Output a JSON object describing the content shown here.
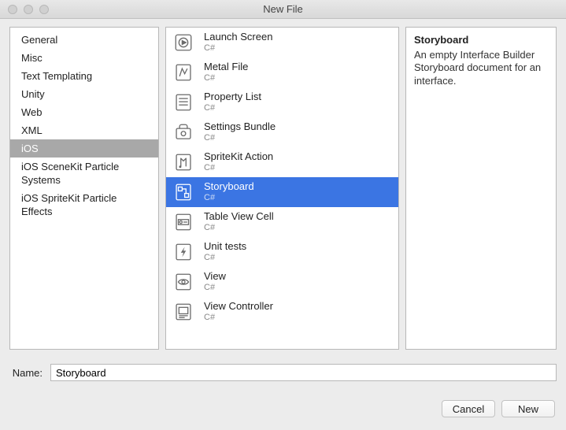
{
  "window": {
    "title": "New File"
  },
  "categories": [
    {
      "label": "General",
      "selected": false
    },
    {
      "label": "Misc",
      "selected": false
    },
    {
      "label": "Text Templating",
      "selected": false
    },
    {
      "label": "Unity",
      "selected": false
    },
    {
      "label": "Web",
      "selected": false
    },
    {
      "label": "XML",
      "selected": false
    },
    {
      "label": "iOS",
      "selected": true
    },
    {
      "label": "iOS SceneKit Particle Systems",
      "selected": false
    },
    {
      "label": "iOS SpriteKit Particle Effects",
      "selected": false
    }
  ],
  "templates": [
    {
      "name": "Launch Screen",
      "sub": "C#",
      "icon": "play-circle",
      "selected": false
    },
    {
      "name": "Metal File",
      "sub": "C#",
      "icon": "metal",
      "selected": false
    },
    {
      "name": "Property List",
      "sub": "C#",
      "icon": "list",
      "selected": false
    },
    {
      "name": "Settings Bundle",
      "sub": "C#",
      "icon": "bundle",
      "selected": false
    },
    {
      "name": "SpriteKit Action",
      "sub": "C#",
      "icon": "sprite",
      "selected": false
    },
    {
      "name": "Storyboard",
      "sub": "C#",
      "icon": "storyboard",
      "selected": true
    },
    {
      "name": "Table View Cell",
      "sub": "C#",
      "icon": "table-cell",
      "selected": false
    },
    {
      "name": "Unit tests",
      "sub": "C#",
      "icon": "bolt",
      "selected": false
    },
    {
      "name": "View",
      "sub": "C#",
      "icon": "eye",
      "selected": false
    },
    {
      "name": "View Controller",
      "sub": "C#",
      "icon": "controller",
      "selected": false
    }
  ],
  "details": {
    "title": "Storyboard",
    "body": "An empty Interface Builder Storyboard document for an interface."
  },
  "name_field": {
    "label": "Name:",
    "value": "Storyboard"
  },
  "buttons": {
    "cancel": "Cancel",
    "new": "New"
  }
}
